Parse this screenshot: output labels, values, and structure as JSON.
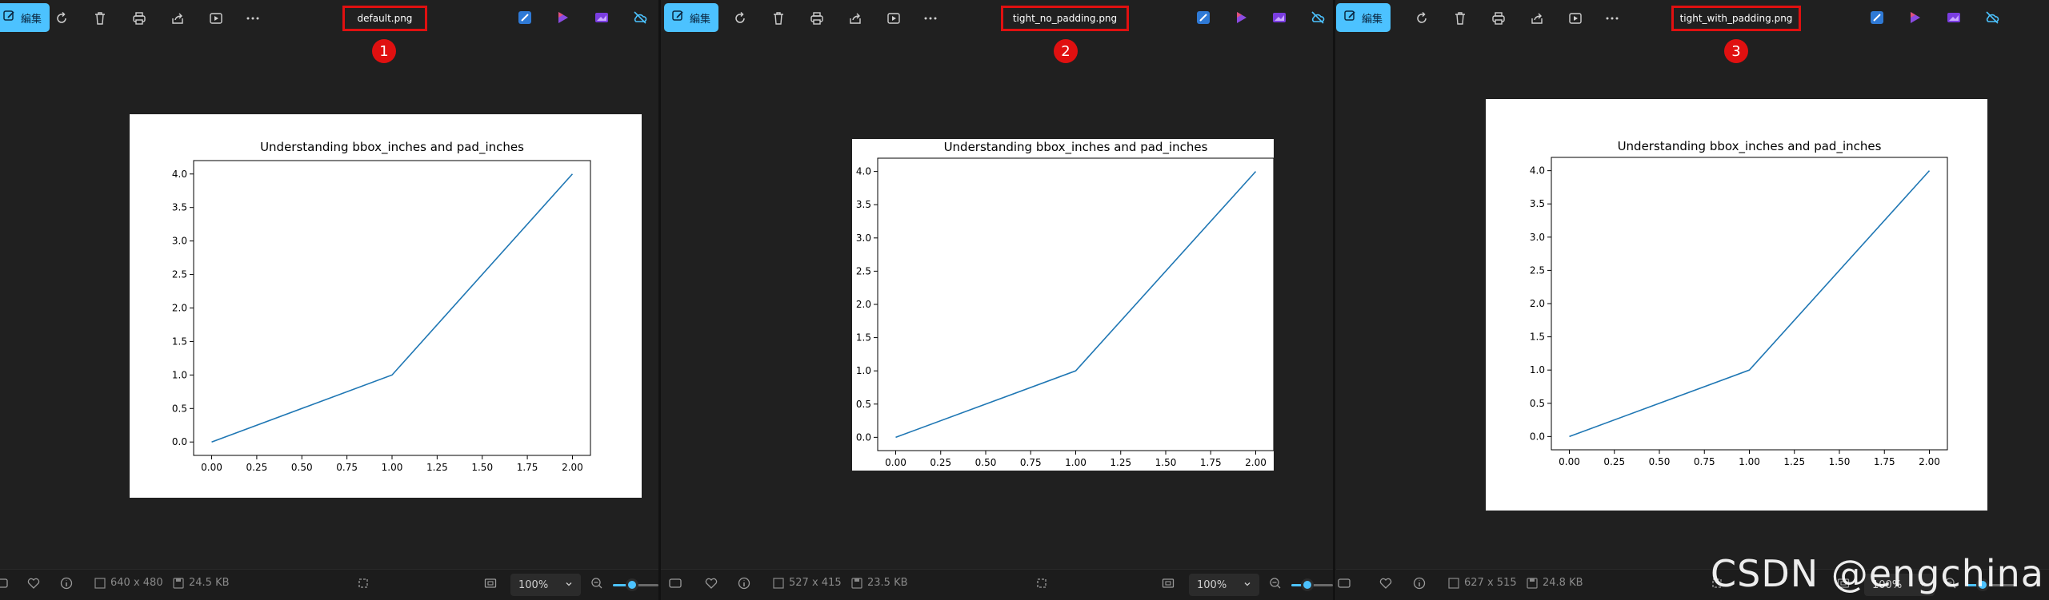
{
  "panes": [
    {
      "edit_label": "編集",
      "filename": "default.png",
      "badge": "1",
      "image_dims": "640 x 480",
      "file_size": "24.5 KB",
      "zoom": "100%"
    },
    {
      "edit_label": "編集",
      "filename": "tight_no_padding.png",
      "badge": "2",
      "image_dims": "527 x 415",
      "file_size": "23.5 KB",
      "zoom": "100%"
    },
    {
      "edit_label": "編集",
      "filename": "tight_with_padding.png",
      "badge": "3",
      "image_dims": "627 x 515",
      "file_size": "24.8 KB",
      "zoom": "100%"
    }
  ],
  "toolbar_icons": [
    "edit-icon",
    "rotate-icon",
    "delete-icon",
    "print-icon",
    "share-icon",
    "slideshow-icon",
    "more-icon"
  ],
  "app_icons": [
    "paint-icon",
    "clipchamp-icon",
    "photos-editor-icon",
    "cloud-off-icon"
  ],
  "accent_color": "#4cc2ff",
  "highlight_color": "#e01010",
  "watermark": "CSDN @engchina",
  "chart_data": {
    "type": "line",
    "title": "Understanding bbox_inches and pad_inches",
    "xlabel": "",
    "ylabel": "",
    "x": [
      0,
      1,
      2
    ],
    "y": [
      0,
      1,
      4
    ],
    "series": [
      {
        "x": [
          0,
          1,
          2
        ],
        "values": [
          0,
          1,
          4
        ],
        "color": "#1f77b4"
      }
    ],
    "xlim": [
      -0.1,
      2.1
    ],
    "ylim": [
      -0.2,
      4.2
    ],
    "xticks": [
      "0.00",
      "0.25",
      "0.50",
      "0.75",
      "1.00",
      "1.25",
      "1.50",
      "1.75",
      "2.00"
    ],
    "yticks": [
      "0.0",
      "0.5",
      "1.0",
      "1.5",
      "2.0",
      "2.5",
      "3.0",
      "3.5",
      "4.0"
    ],
    "grid": false
  }
}
